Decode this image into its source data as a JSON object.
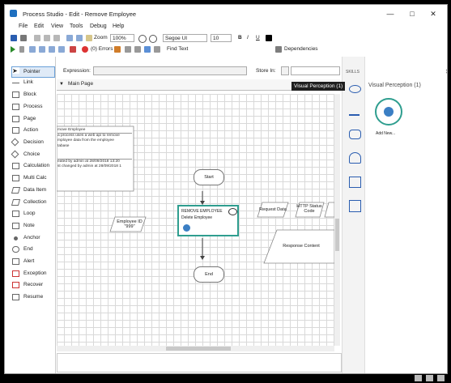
{
  "window": {
    "title": "Process Studio - Edit - Remove Employee",
    "minimize": "—",
    "maximize": "□",
    "close": "✕"
  },
  "menu": [
    "File",
    "Edit",
    "View",
    "Tools",
    "Debug",
    "Help"
  ],
  "toolbar1": {
    "zoom_label": "Zoom",
    "zoom_value": "100%",
    "font_name": "Segoe UI",
    "font_size": "10",
    "bold": "B",
    "italic": "I",
    "underline": "U"
  },
  "toolbar2": {
    "errors_label": "(0) Errors",
    "find_label": "Find Text",
    "dependencies_label": "Dependencies"
  },
  "tools": [
    "Pointer",
    "Link",
    "Block",
    "Process",
    "Page",
    "Action",
    "Decision",
    "Choice",
    "Calculation",
    "Multi Calc",
    "Data Item",
    "Collection",
    "Loop",
    "Note",
    "Anchor",
    "End",
    "Alert",
    "Exception",
    "Recover",
    "Resume"
  ],
  "expression_label": "Expression:",
  "store_in_label": "Store In:",
  "page_tab": "Main Page",
  "tooltip": "Visual Perception (1)",
  "skills_label": "SKILLS",
  "right_panel": {
    "title": "Visual Perception (1)",
    "add_new": "Add New..."
  },
  "diagram": {
    "note_lines": [
      "move Employee",
      "a process uses a web api to remove",
      "mployee data from the employee",
      "tabase",
      "eated by admin at 28/09/2018 13:20",
      "st changed by admin at 28/09/2018 1"
    ],
    "start": "Start",
    "end": "End",
    "action_title": "REMOVE EMPLOYEE",
    "action_sub": "Delete Employee",
    "employee_id": "Employee ID\n\"999\"",
    "request_data": "Request Data",
    "http_status": "HTTP Status\nCode",
    "response_content": "Response Content"
  },
  "colors": {
    "accent": "#1e6fbf",
    "action_border": "#2f9e8f",
    "tooltip_bg": "#1f1f1f"
  }
}
